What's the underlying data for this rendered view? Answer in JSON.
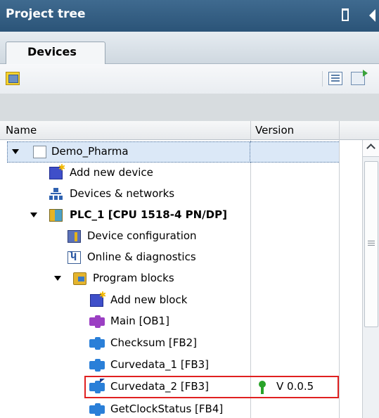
{
  "panel": {
    "title": "Project tree"
  },
  "tabs": [
    {
      "label": "Devices",
      "active": true
    }
  ],
  "columns": {
    "name": "Name",
    "version": "Version"
  },
  "tree": {
    "root": "Demo_Pharma",
    "add_new_device": "Add new device",
    "devices_networks": "Devices & networks",
    "plc": "PLC_1 [CPU 1518-4 PN/DP]",
    "device_configuration": "Device configuration",
    "online_diagnostics": "Online & diagnostics",
    "program_blocks": "Program blocks",
    "add_new_block": "Add new block",
    "main": "Main [OB1]",
    "checksum": "Checksum [FB2]",
    "curvedata_1": "Curvedata_1 [FB3]",
    "curvedata_2": "Curvedata_2 [FB3]",
    "curvedata_2_version": "V 0.0.5",
    "getclockstatus": "GetClockStatus [FB4]"
  },
  "colors": {
    "titlebar": "#2b5478",
    "highlight": "#e02020",
    "selection": "#dbe8f7"
  }
}
